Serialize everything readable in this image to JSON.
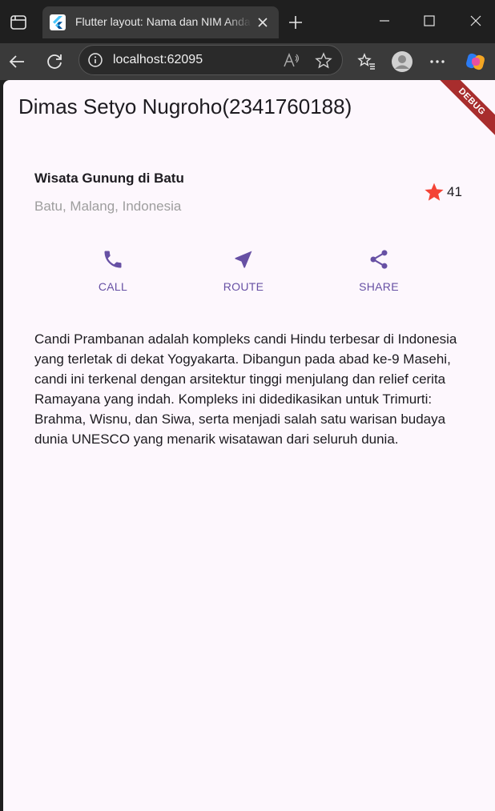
{
  "browser": {
    "tab_title": "Flutter layout: Nama dan NIM Anda",
    "url": "localhost:62095",
    "icons": [
      "tab-list-icon",
      "flutter-logo-icon",
      "close-icon",
      "plus-icon",
      "minimize-icon",
      "maximize-icon",
      "back-arrow-icon",
      "reload-icon",
      "info-icon",
      "read-aloud-icon",
      "star-outline-icon",
      "favorites-icon",
      "profile-icon",
      "more-icon",
      "copilot-icon"
    ]
  },
  "app": {
    "title": "Dimas Setyo Nugroho(2341760188)",
    "debug_label": "DEBUG",
    "place_title": "Wisata Gunung di Batu",
    "place_location": "Batu, Malang, Indonesia",
    "rating_count": "41",
    "star_color": "#f44336",
    "accent_color": "#6750a4",
    "actions": [
      {
        "label": "CALL",
        "icon": "phone-icon"
      },
      {
        "label": "ROUTE",
        "icon": "near-me-icon"
      },
      {
        "label": "SHARE",
        "icon": "share-icon"
      }
    ],
    "description": "Candi Prambanan adalah kompleks candi Hindu terbesar di Indonesia yang terletak di dekat Yogyakarta. Dibangun pada abad ke-9 Masehi, candi ini terkenal dengan arsitektur tinggi menjulang dan relief cerita Ramayana yang indah. Kompleks ini didedikasikan untuk Trimurti: Brahma, Wisnu, dan Siwa, serta menjadi salah satu warisan budaya dunia UNESCO yang menarik wisatawan dari seluruh dunia."
  }
}
